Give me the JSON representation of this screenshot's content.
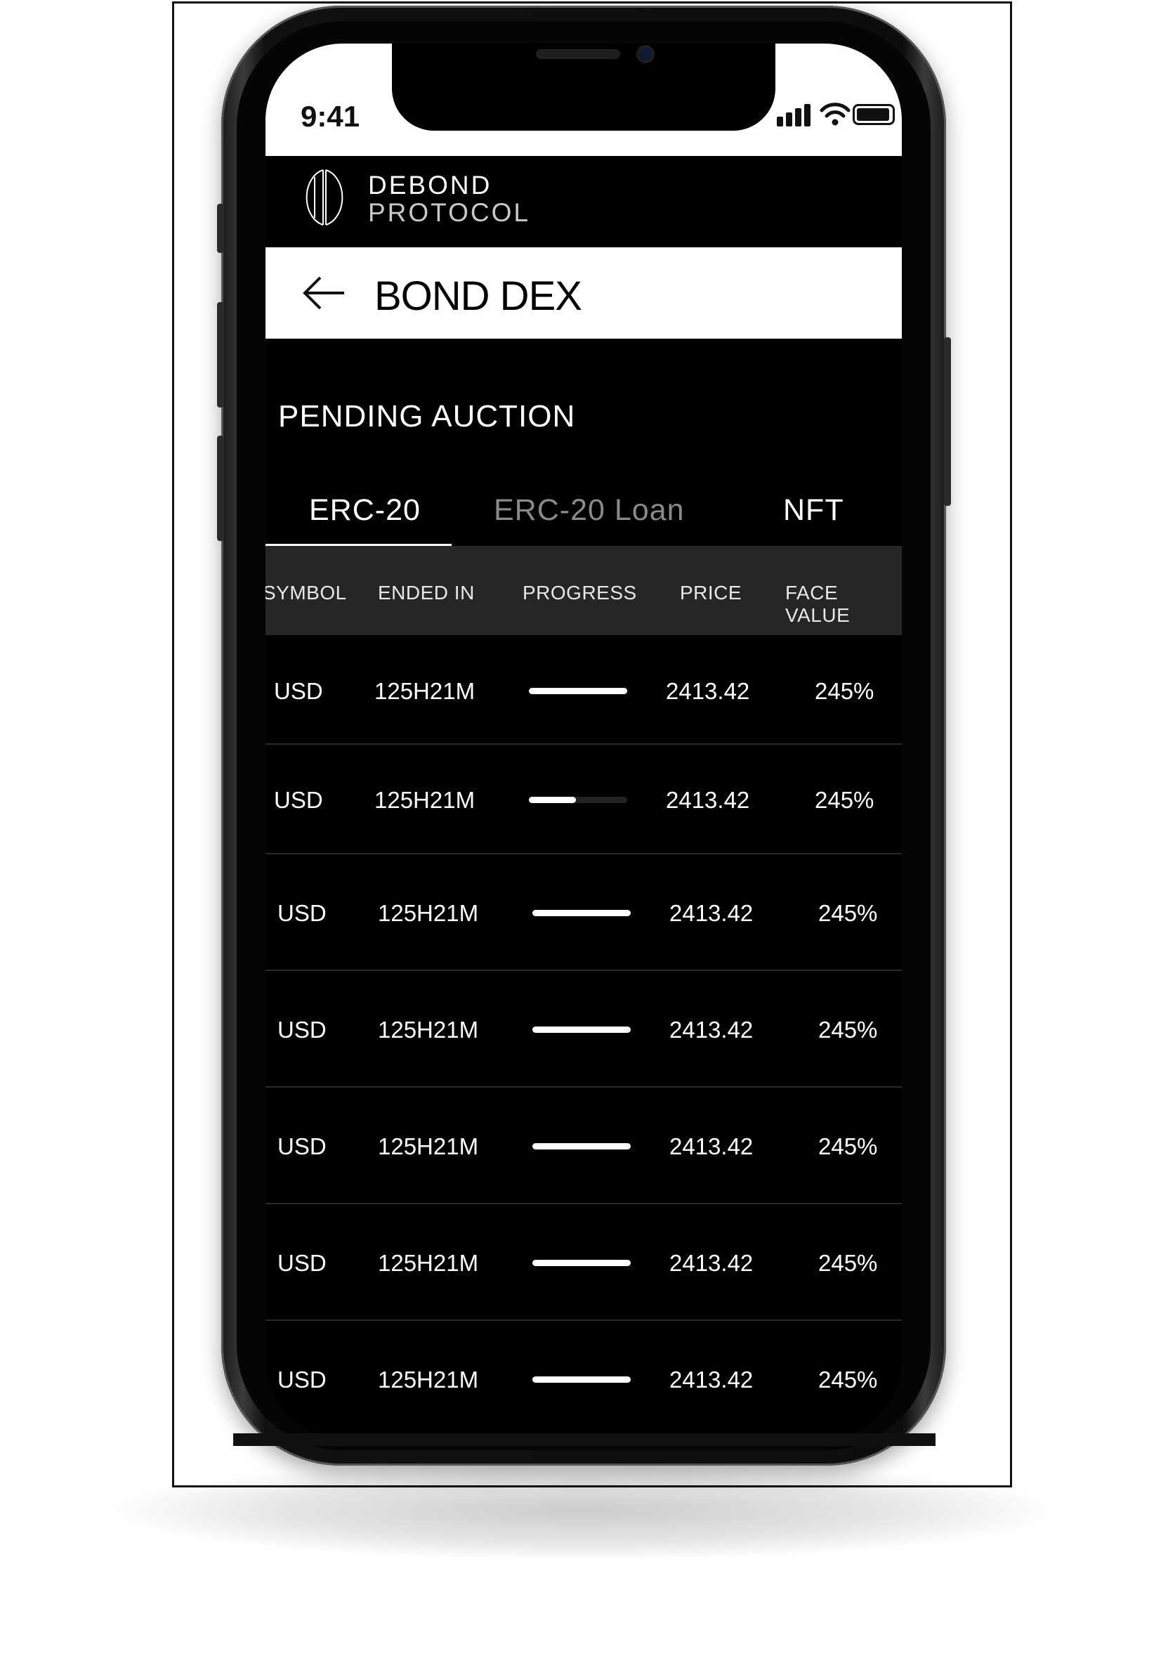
{
  "status_bar": {
    "time": "9:41"
  },
  "brand": {
    "line1": "DEBOND",
    "line2": "PROTOCOL"
  },
  "header": {
    "title": "BOND DEX"
  },
  "section_title": "PENDING AUCTION",
  "tabs": [
    {
      "label": "ERC-20",
      "active": true
    },
    {
      "label": "ERC-20 Loan",
      "active": false
    },
    {
      "label": "NFT",
      "active": false
    }
  ],
  "columns": [
    "SYMBOL",
    "ENDED IN",
    "PROGRESS",
    "PRICE",
    "FACE VALUE"
  ],
  "rows": [
    {
      "symbol": "USD",
      "ended_in": "125H21M",
      "progress": 1.0,
      "price": "2413.42",
      "face_value": "245%"
    },
    {
      "symbol": "USD",
      "ended_in": "125H21M",
      "progress": 0.48,
      "price": "2413.42",
      "face_value": "245%"
    },
    {
      "symbol": "USD",
      "ended_in": "125H21M",
      "progress": 1.0,
      "price": "2413.42",
      "face_value": "245%"
    },
    {
      "symbol": "USD",
      "ended_in": "125H21M",
      "progress": 1.0,
      "price": "2413.42",
      "face_value": "245%"
    },
    {
      "symbol": "USD",
      "ended_in": "125H21M",
      "progress": 1.0,
      "price": "2413.42",
      "face_value": "245%"
    },
    {
      "symbol": "USD",
      "ended_in": "125H21M",
      "progress": 1.0,
      "price": "2413.42",
      "face_value": "245%"
    },
    {
      "symbol": "USD",
      "ended_in": "125H21M",
      "progress": 1.0,
      "price": "2413.42",
      "face_value": "245%"
    }
  ],
  "icons": {
    "back": "back-arrow-icon",
    "logo": "debond-logo-icon",
    "signal": "cellular-signal-icon",
    "wifi": "wifi-icon",
    "battery": "battery-icon"
  },
  "colors": {
    "background": "#000000",
    "accent": "#ffffff",
    "muted": "#8a8a8a",
    "header_row": "#262626"
  }
}
